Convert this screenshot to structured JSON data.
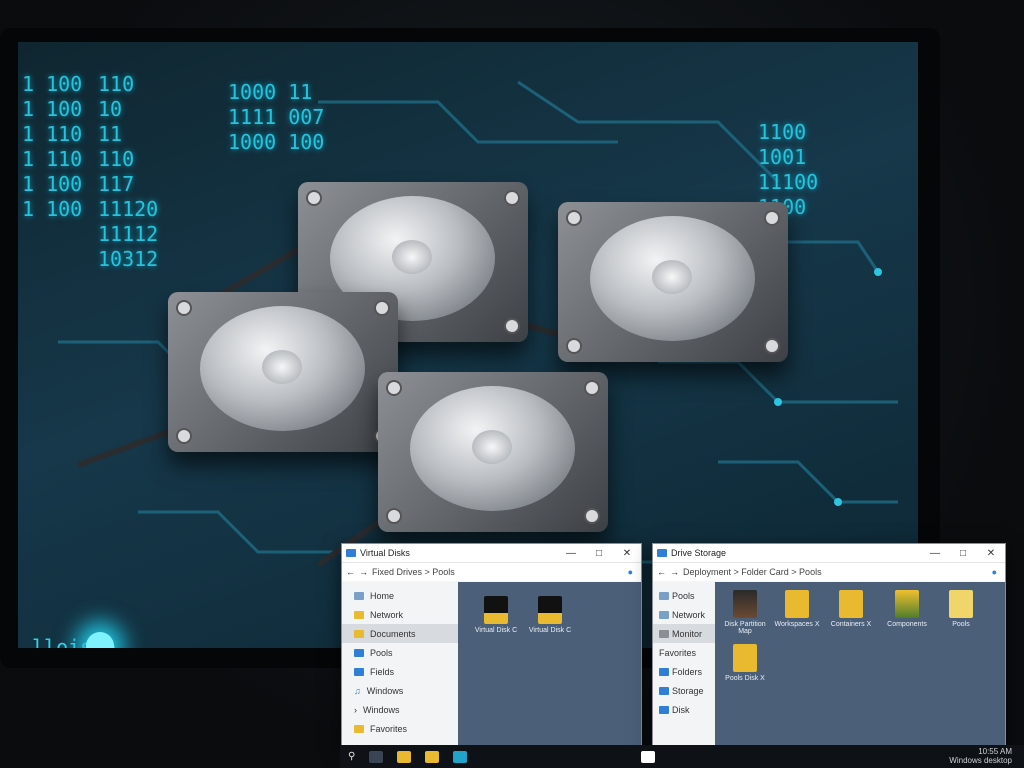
{
  "binary_left": "1 100\n1 100\n1 110\n1 110\n1 100\n1 100",
  "binary_mid": "110\n10\n11\n110\n117\n11120\n11112\n10312",
  "binary_top": "1000 11\n1111 007\n1000 100",
  "binary_right": "1100\n1001\n11100\n1100",
  "glow_text": "lloislo",
  "windows": [
    {
      "title": "Virtual Disks",
      "path": "Fixed Drives > Pools",
      "nav": [
        "Home",
        "Network",
        "Documents",
        "Pools",
        "Fields",
        "Windows",
        "Windows",
        "Favorites"
      ],
      "selected_nav": 2,
      "files": [
        {
          "label": "Virtual Disk C"
        },
        {
          "label": "Virtual Disk C"
        }
      ]
    },
    {
      "title": "Drive Storage",
      "path": "Deployment > Folder Card > Pools",
      "nav": [
        "Pools",
        "Network",
        "Monitor",
        "Favorites",
        "Folders",
        "Storage",
        "Disk"
      ],
      "selected_nav": 2,
      "files": [
        {
          "label": "Disk Partition Map",
          "color": "#5a4b3c"
        },
        {
          "label": "Workspaces X",
          "color": "#e9b930"
        },
        {
          "label": "Containers X",
          "color": "#e9b930"
        },
        {
          "label": "Components",
          "color": "#5d7d3c"
        },
        {
          "label": "Pools",
          "color": "#f0d66a"
        },
        {
          "label": "Pools Disk X",
          "color": "#e9b930"
        }
      ]
    }
  ],
  "taskbar": {
    "time": "10:55 AM",
    "date": "Windows desktop"
  },
  "colors": {
    "accent": "#27c3dc",
    "folder": "#e9b930",
    "explorer_bg": "#4b5f79"
  }
}
